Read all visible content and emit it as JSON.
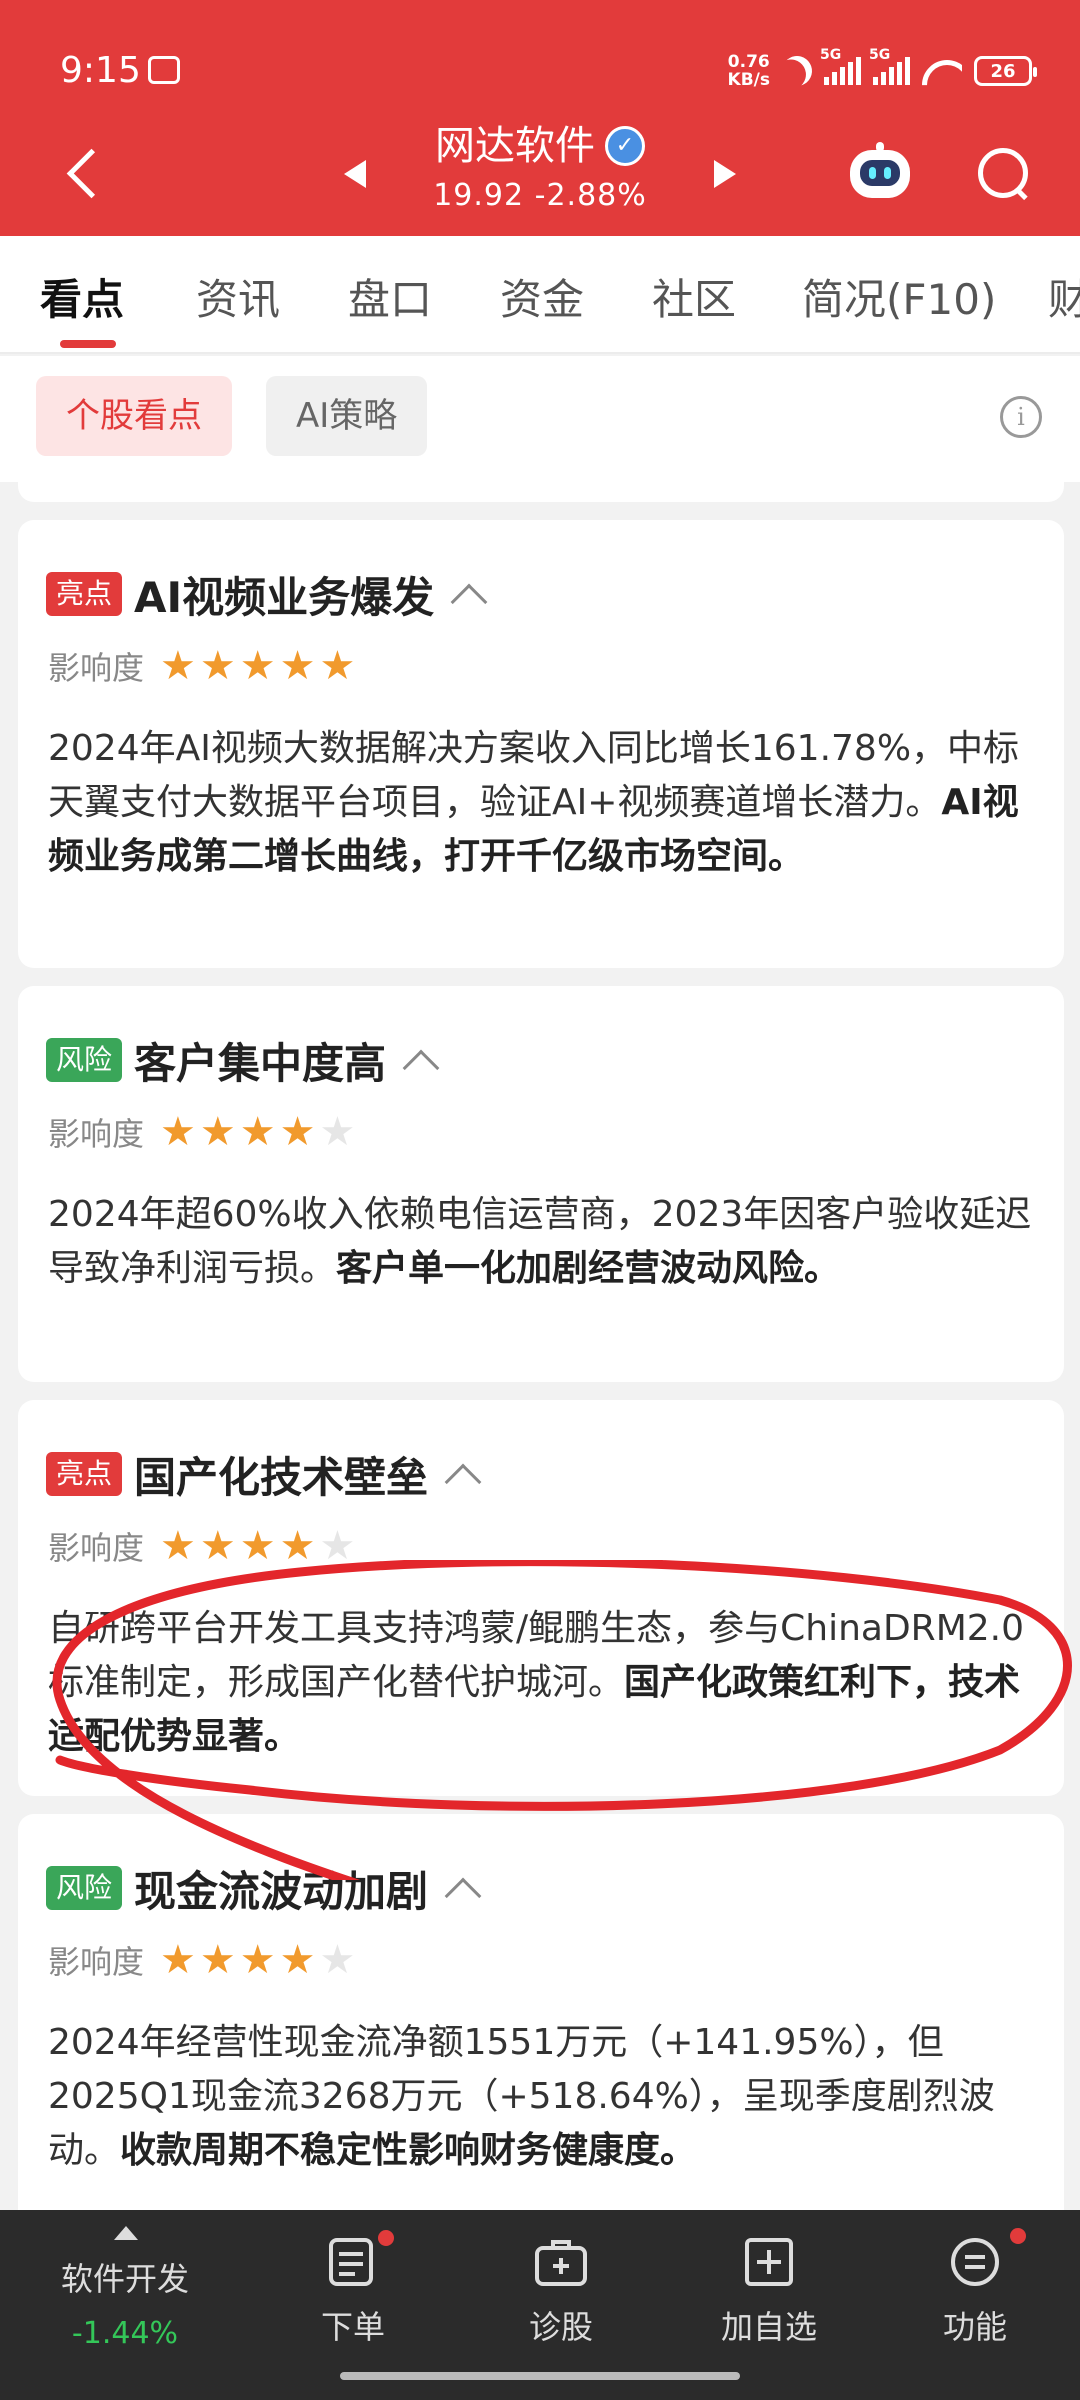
{
  "status_bar": {
    "time": "9:15",
    "net_speed_value": "0.76",
    "net_speed_unit": "KB/s",
    "sig1_label": "5G",
    "sig2_label": "5G",
    "battery": "26"
  },
  "header": {
    "stock_name": "网达软件",
    "verified_mark": "✓",
    "price": "19.92",
    "change_pct": "-2.88%"
  },
  "tabs": [
    {
      "label": "看点",
      "active": true
    },
    {
      "label": "资讯"
    },
    {
      "label": "盘口"
    },
    {
      "label": "资金"
    },
    {
      "label": "社区"
    },
    {
      "label": "简况(F10)"
    },
    {
      "label": "财"
    }
  ],
  "subtabs": {
    "stock_highlights": "个股看点",
    "ai_strategy": "AI策略",
    "info_icon": "i"
  },
  "impact_label": "影响度",
  "cards": [
    {
      "tag": "亮点",
      "tag_type": "highlight",
      "title": "AI视频业务爆发",
      "stars": 5,
      "body_normal": "2024年AI视频大数据解决方案收入同比增长161.78%，中标天翼支付大数据平台项目，验证AI+视频赛道增长潜力。",
      "body_bold": "AI视频业务成第二增长曲线，打开千亿级市场空间。"
    },
    {
      "tag": "风险",
      "tag_type": "risk",
      "title": "客户集中度高",
      "stars": 4,
      "body_normal": "2024年超60%收入依赖电信运营商，2023年因客户验收延迟导致净利润亏损。",
      "body_bold": "客户单一化加剧经营波动风险。"
    },
    {
      "tag": "亮点",
      "tag_type": "highlight",
      "title": "国产化技术壁垒",
      "stars": 4,
      "body_normal": "自研跨平台开发工具支持鸿蒙/鲲鹏生态，参与ChinaDRM2.0标准制定，形成国产化替代护城河。",
      "body_bold": "国产化政策红利下，技术适配优势显著。"
    },
    {
      "tag": "风险",
      "tag_type": "risk",
      "title": "现金流波动加剧",
      "stars": 4,
      "body_normal": "2024年经营性现金流净额1551万元（+141.95%），但2025Q1现金流3268万元（+518.64%），呈现季度剧烈波动。",
      "body_bold": "收款周期不稳定性影响财务健康度。"
    }
  ],
  "bottom_bar": {
    "sector_name": "软件开发",
    "sector_change": "-1.44%",
    "items": [
      {
        "label": "下单",
        "icon": "order-icon"
      },
      {
        "label": "诊股",
        "icon": "diagnose-icon"
      },
      {
        "label": "加自选",
        "icon": "add-watchlist-icon"
      },
      {
        "label": "功能",
        "icon": "menu-icon"
      }
    ]
  },
  "colors": {
    "brand_red": "#e23b3b",
    "risk_green": "#3aa659",
    "star_orange": "#f19a2d",
    "down_green": "#34c759"
  }
}
